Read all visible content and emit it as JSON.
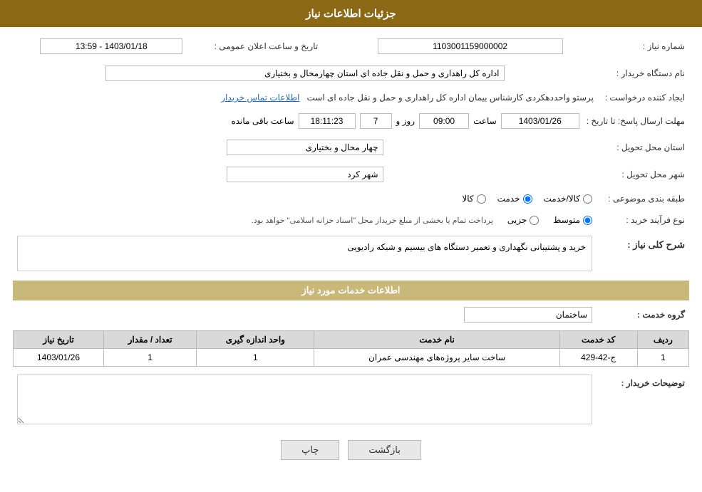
{
  "header": {
    "title": "جزئیات اطلاعات نیاز"
  },
  "fields": {
    "need_number_label": "شماره نیاز :",
    "need_number_value": "1103001159000002",
    "announcement_date_label": "تاریخ و ساعت اعلان عمومی :",
    "announcement_date_value": "1403/01/18 - 13:59",
    "buyer_org_label": "نام دستگاه خریدار :",
    "buyer_org_value": "اداره کل راهداری و حمل و نقل جاده ای استان چهارمحال و بختیاری",
    "creator_label": "ایجاد کننده درخواست :",
    "creator_value": "پرستو واحددهکردی کارشناس بیمان اداره کل راهداری و حمل و نقل جاده ای است",
    "creator_link": "اطلاعات تماس خریدار",
    "deadline_label": "مهلت ارسال پاسخ: تا تاریخ :",
    "deadline_date": "1403/01/26",
    "deadline_time_label": "ساعت",
    "deadline_time": "09:00",
    "deadline_day_label": "روز و",
    "deadline_days": "7",
    "deadline_remaining_label": "ساعت باقی مانده",
    "deadline_remaining": "18:11:23",
    "province_label": "استان محل تحویل :",
    "province_value": "چهار محال و بختیاری",
    "city_label": "شهر محل تحویل :",
    "city_value": "شهر کرد",
    "category_label": "طبقه بندی موضوعی :",
    "category_options": [
      {
        "label": "کالا",
        "value": "kala"
      },
      {
        "label": "خدمت",
        "value": "khadamat"
      },
      {
        "label": "کالا/خدمت",
        "value": "kala_khadamat"
      }
    ],
    "category_selected": "khadamat",
    "purchase_type_label": "نوع فرآیند خرید :",
    "purchase_type_options": [
      {
        "label": "جزیی",
        "value": "jozi"
      },
      {
        "label": "متوسط",
        "value": "motavaset"
      }
    ],
    "purchase_type_selected": "motavaset",
    "purchase_type_note": "پرداخت تمام یا بخشی از مبلغ خریداز محل \"اسناد خزانه اسلامی\" خواهد بود.",
    "description_label": "شرح کلی نیاز :",
    "description_value": "خرید و پشتیبانی نگهداری و تعمیر دستگاه های بیسیم و شبکه رادیویی",
    "services_section_label": "اطلاعات خدمات مورد نیاز",
    "service_group_label": "گروه خدمت :",
    "service_group_value": "ساختمان",
    "table": {
      "headers": [
        "ردیف",
        "کد خدمت",
        "نام خدمت",
        "واحد اندازه گیری",
        "تعداد / مقدار",
        "تاریخ نیاز"
      ],
      "rows": [
        {
          "row_num": "1",
          "service_code": "ج-42-429",
          "service_name": "ساخت سایر پروژه‌های مهندسی عمران",
          "unit": "1",
          "quantity": "1",
          "date": "1403/01/26"
        }
      ]
    },
    "buyer_desc_label": "توضیحات خریدار :",
    "buyer_desc_value": ""
  },
  "buttons": {
    "print": "چاپ",
    "back": "بازگشت"
  }
}
